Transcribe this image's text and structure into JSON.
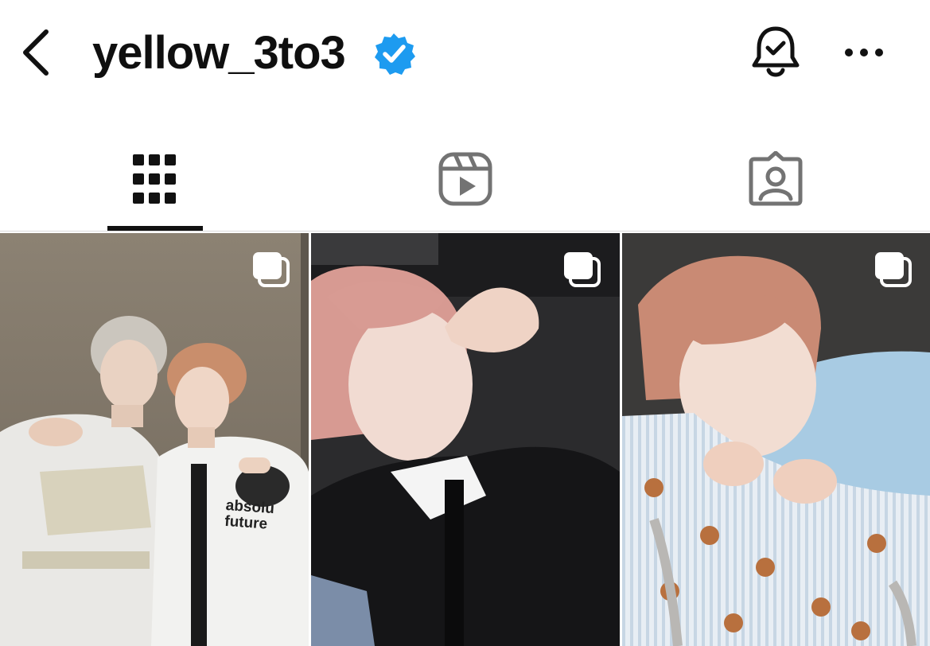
{
  "header": {
    "username": "yellow_3to3",
    "verified": true,
    "icons": {
      "back": "chevron-left-icon",
      "verified": "verified-badge-icon",
      "notifications": "bell-check-icon",
      "more": "more-horizontal-icon"
    }
  },
  "tabs": [
    {
      "name": "posts",
      "icon": "grid-icon",
      "active": true
    },
    {
      "name": "reels",
      "icon": "reels-icon",
      "active": false
    },
    {
      "name": "tagged",
      "icon": "tagged-person-icon",
      "active": false
    }
  ],
  "grid": {
    "posts": [
      {
        "type": "carousel",
        "icon": "carousel-icon",
        "photo_text": "absolute\nfuture"
      },
      {
        "type": "carousel",
        "icon": "carousel-icon"
      },
      {
        "type": "carousel",
        "icon": "carousel-icon"
      }
    ]
  },
  "colors": {
    "verified_blue": "#1d9bf0",
    "text_primary": "#0f0f0f",
    "icon_gray": "#737373",
    "active_underline": "#111111",
    "divider": "#dbdbdb"
  }
}
